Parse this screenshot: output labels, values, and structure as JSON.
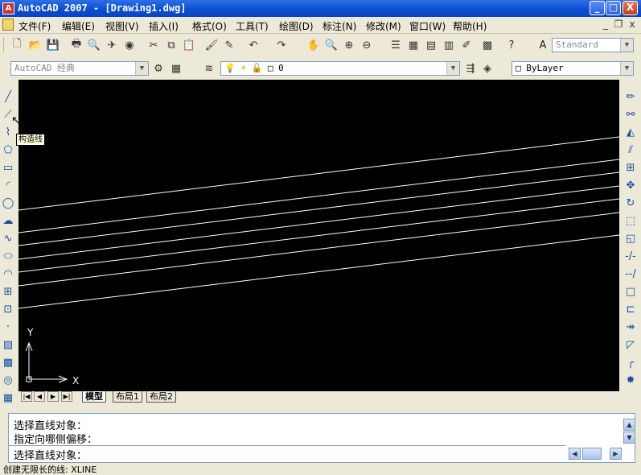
{
  "window": {
    "title": "AutoCAD 2007 - [Drawing1.dwg]",
    "app_icon": "A",
    "minimize": "_",
    "maximize": "□",
    "close": "X"
  },
  "menu": {
    "items": [
      "文件(F)",
      "编辑(E)",
      "视图(V)",
      "插入(I)",
      "格式(O)",
      "工具(T)",
      "绘图(D)",
      "标注(N)",
      "修改(M)",
      "窗口(W)",
      "帮助(H)"
    ],
    "doc_minimize": "_",
    "doc_restore": "❐",
    "doc_close": "x"
  },
  "toolbar": {
    "text_style": "Standard",
    "workspace": "AutoCAD 经典",
    "layer": "0",
    "color": "ByLayer"
  },
  "icons": {
    "standard": [
      "new-icon",
      "open-icon",
      "save-icon",
      "plot-icon",
      "plot-preview-icon",
      "publish-icon",
      "3d-dwf-icon",
      "cut-icon",
      "copy-icon",
      "paste-icon",
      "match-properties-icon",
      "block-editor-icon",
      "undo-icon",
      "redo-icon",
      "pan-icon",
      "zoom-realtime-icon",
      "zoom-window-icon",
      "zoom-previous-icon",
      "properties-icon",
      "design-center-icon",
      "tool-palettes-icon",
      "sheet-set-icon",
      "markup-icon",
      "calculator-icon",
      "help-icon"
    ],
    "draw": [
      "line-icon",
      "construction-line-icon",
      "polyline-icon",
      "polygon-icon",
      "rectangle-icon",
      "arc-icon",
      "circle-icon",
      "revision-cloud-icon",
      "spline-icon",
      "ellipse-icon",
      "ellipse-arc-icon",
      "insert-block-icon",
      "make-block-icon",
      "point-icon",
      "hatch-icon",
      "gradient-icon",
      "region-icon",
      "table-icon"
    ],
    "modify": [
      "erase-icon",
      "copy-object-icon",
      "mirror-icon",
      "offset-icon",
      "array-icon",
      "move-icon",
      "rotate-icon",
      "scale-icon",
      "stretch-icon",
      "trim-icon",
      "extend-icon",
      "break-at-point-icon",
      "break-icon",
      "join-icon",
      "chamfer-icon",
      "fillet-icon",
      "explode-icon"
    ]
  },
  "tooltip": "构造线",
  "ucs": {
    "x_label": "X",
    "y_label": "Y"
  },
  "tabs": {
    "model": "模型",
    "layout1": "布局1",
    "layout2": "布局2"
  },
  "command": {
    "lines": [
      "选择直线对象：",
      "指定向哪侧偏移：",
      "选择直线对象："
    ]
  },
  "status": {
    "text": "创建无限长的线:  XLINE"
  }
}
